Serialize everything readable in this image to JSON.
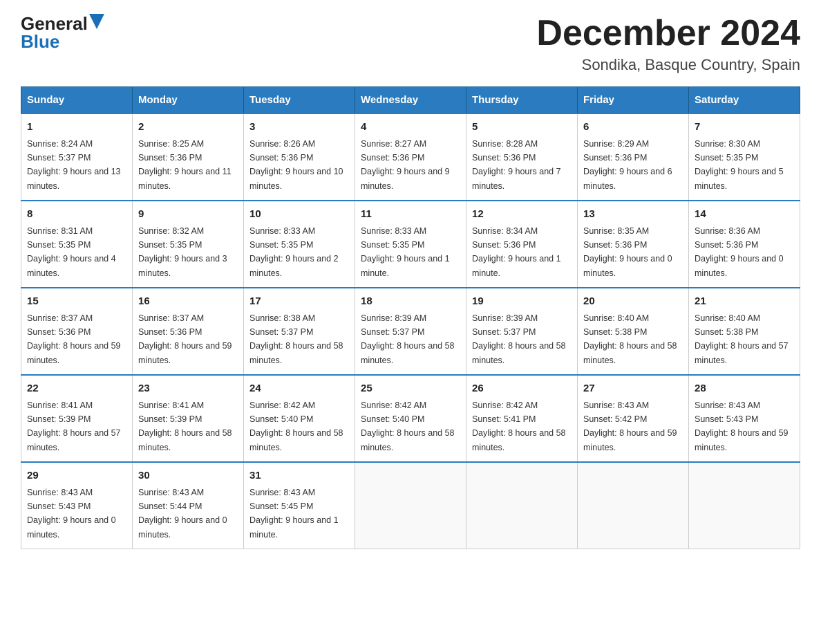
{
  "logo": {
    "general": "General",
    "blue": "Blue"
  },
  "title": "December 2024",
  "subtitle": "Sondika, Basque Country, Spain",
  "weekdays": [
    "Sunday",
    "Monday",
    "Tuesday",
    "Wednesday",
    "Thursday",
    "Friday",
    "Saturday"
  ],
  "weeks": [
    [
      {
        "day": "1",
        "sunrise": "8:24 AM",
        "sunset": "5:37 PM",
        "daylight": "9 hours and 13 minutes."
      },
      {
        "day": "2",
        "sunrise": "8:25 AM",
        "sunset": "5:36 PM",
        "daylight": "9 hours and 11 minutes."
      },
      {
        "day": "3",
        "sunrise": "8:26 AM",
        "sunset": "5:36 PM",
        "daylight": "9 hours and 10 minutes."
      },
      {
        "day": "4",
        "sunrise": "8:27 AM",
        "sunset": "5:36 PM",
        "daylight": "9 hours and 9 minutes."
      },
      {
        "day": "5",
        "sunrise": "8:28 AM",
        "sunset": "5:36 PM",
        "daylight": "9 hours and 7 minutes."
      },
      {
        "day": "6",
        "sunrise": "8:29 AM",
        "sunset": "5:36 PM",
        "daylight": "9 hours and 6 minutes."
      },
      {
        "day": "7",
        "sunrise": "8:30 AM",
        "sunset": "5:35 PM",
        "daylight": "9 hours and 5 minutes."
      }
    ],
    [
      {
        "day": "8",
        "sunrise": "8:31 AM",
        "sunset": "5:35 PM",
        "daylight": "9 hours and 4 minutes."
      },
      {
        "day": "9",
        "sunrise": "8:32 AM",
        "sunset": "5:35 PM",
        "daylight": "9 hours and 3 minutes."
      },
      {
        "day": "10",
        "sunrise": "8:33 AM",
        "sunset": "5:35 PM",
        "daylight": "9 hours and 2 minutes."
      },
      {
        "day": "11",
        "sunrise": "8:33 AM",
        "sunset": "5:35 PM",
        "daylight": "9 hours and 1 minute."
      },
      {
        "day": "12",
        "sunrise": "8:34 AM",
        "sunset": "5:36 PM",
        "daylight": "9 hours and 1 minute."
      },
      {
        "day": "13",
        "sunrise": "8:35 AM",
        "sunset": "5:36 PM",
        "daylight": "9 hours and 0 minutes."
      },
      {
        "day": "14",
        "sunrise": "8:36 AM",
        "sunset": "5:36 PM",
        "daylight": "9 hours and 0 minutes."
      }
    ],
    [
      {
        "day": "15",
        "sunrise": "8:37 AM",
        "sunset": "5:36 PM",
        "daylight": "8 hours and 59 minutes."
      },
      {
        "day": "16",
        "sunrise": "8:37 AM",
        "sunset": "5:36 PM",
        "daylight": "8 hours and 59 minutes."
      },
      {
        "day": "17",
        "sunrise": "8:38 AM",
        "sunset": "5:37 PM",
        "daylight": "8 hours and 58 minutes."
      },
      {
        "day": "18",
        "sunrise": "8:39 AM",
        "sunset": "5:37 PM",
        "daylight": "8 hours and 58 minutes."
      },
      {
        "day": "19",
        "sunrise": "8:39 AM",
        "sunset": "5:37 PM",
        "daylight": "8 hours and 58 minutes."
      },
      {
        "day": "20",
        "sunrise": "8:40 AM",
        "sunset": "5:38 PM",
        "daylight": "8 hours and 58 minutes."
      },
      {
        "day": "21",
        "sunrise": "8:40 AM",
        "sunset": "5:38 PM",
        "daylight": "8 hours and 57 minutes."
      }
    ],
    [
      {
        "day": "22",
        "sunrise": "8:41 AM",
        "sunset": "5:39 PM",
        "daylight": "8 hours and 57 minutes."
      },
      {
        "day": "23",
        "sunrise": "8:41 AM",
        "sunset": "5:39 PM",
        "daylight": "8 hours and 58 minutes."
      },
      {
        "day": "24",
        "sunrise": "8:42 AM",
        "sunset": "5:40 PM",
        "daylight": "8 hours and 58 minutes."
      },
      {
        "day": "25",
        "sunrise": "8:42 AM",
        "sunset": "5:40 PM",
        "daylight": "8 hours and 58 minutes."
      },
      {
        "day": "26",
        "sunrise": "8:42 AM",
        "sunset": "5:41 PM",
        "daylight": "8 hours and 58 minutes."
      },
      {
        "day": "27",
        "sunrise": "8:43 AM",
        "sunset": "5:42 PM",
        "daylight": "8 hours and 59 minutes."
      },
      {
        "day": "28",
        "sunrise": "8:43 AM",
        "sunset": "5:43 PM",
        "daylight": "8 hours and 59 minutes."
      }
    ],
    [
      {
        "day": "29",
        "sunrise": "8:43 AM",
        "sunset": "5:43 PM",
        "daylight": "9 hours and 0 minutes."
      },
      {
        "day": "30",
        "sunrise": "8:43 AM",
        "sunset": "5:44 PM",
        "daylight": "9 hours and 0 minutes."
      },
      {
        "day": "31",
        "sunrise": "8:43 AM",
        "sunset": "5:45 PM",
        "daylight": "9 hours and 1 minute."
      },
      null,
      null,
      null,
      null
    ]
  ]
}
